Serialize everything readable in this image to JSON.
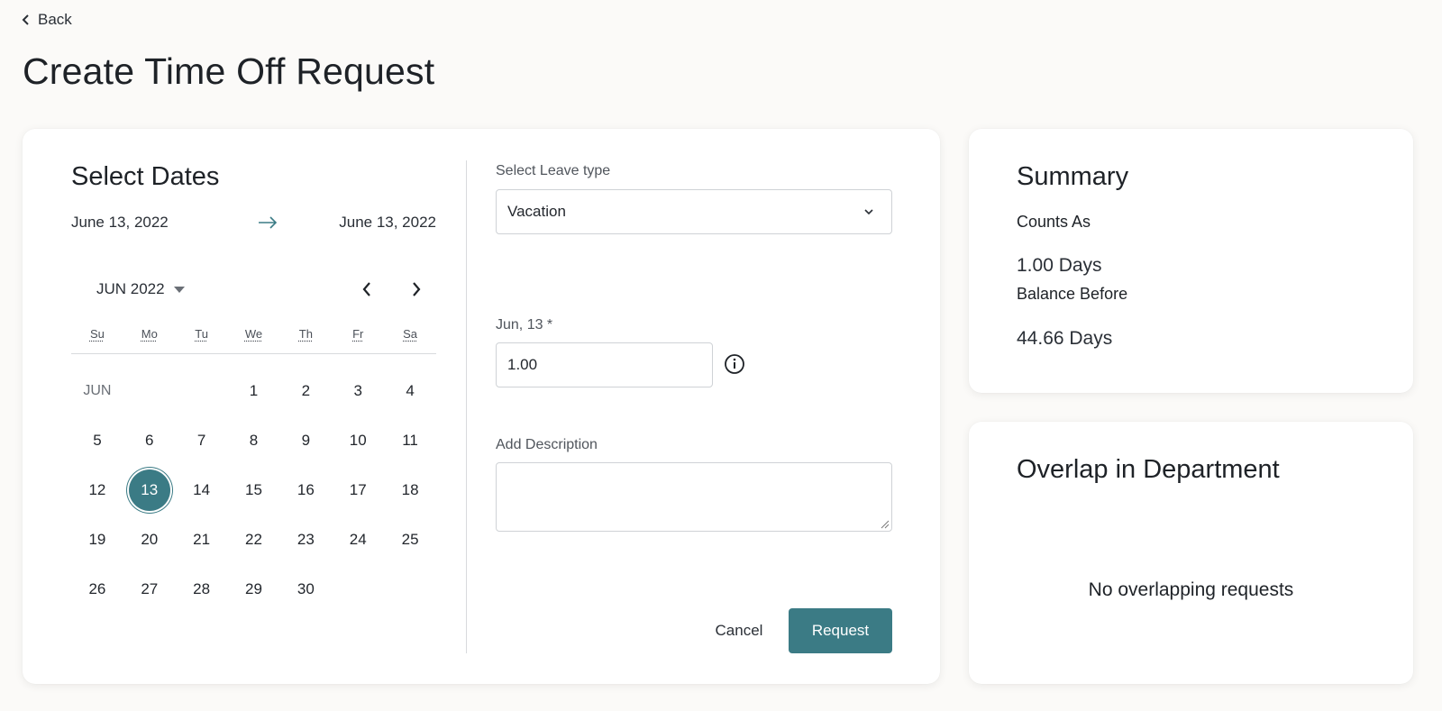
{
  "nav": {
    "back_label": "Back"
  },
  "page": {
    "title": "Create Time Off Request"
  },
  "dates": {
    "title": "Select Dates",
    "start": "June 13, 2022",
    "end": "June 13, 2022",
    "month_label": "JUN 2022",
    "weekdays": [
      "Su",
      "Mo",
      "Tu",
      "We",
      "Th",
      "Fr",
      "Sa"
    ],
    "month_short": "JUN",
    "selected_day": 13
  },
  "form": {
    "leave_label": "Select Leave type",
    "leave_value": "Vacation",
    "day_label": "Jun, 13 *",
    "day_value": "1.00",
    "desc_label": "Add Description",
    "desc_value": "",
    "cancel_label": "Cancel",
    "request_label": "Request"
  },
  "summary": {
    "title": "Summary",
    "counts_label": "Counts As",
    "counts_value": "1.00 Days",
    "balance_label": "Balance Before",
    "balance_value": "44.66 Days"
  },
  "overlap": {
    "title": "Overlap in Department",
    "empty_text": "No overlapping requests"
  },
  "colors": {
    "accent": "#3b7b85",
    "background": "#fbfaf8"
  }
}
